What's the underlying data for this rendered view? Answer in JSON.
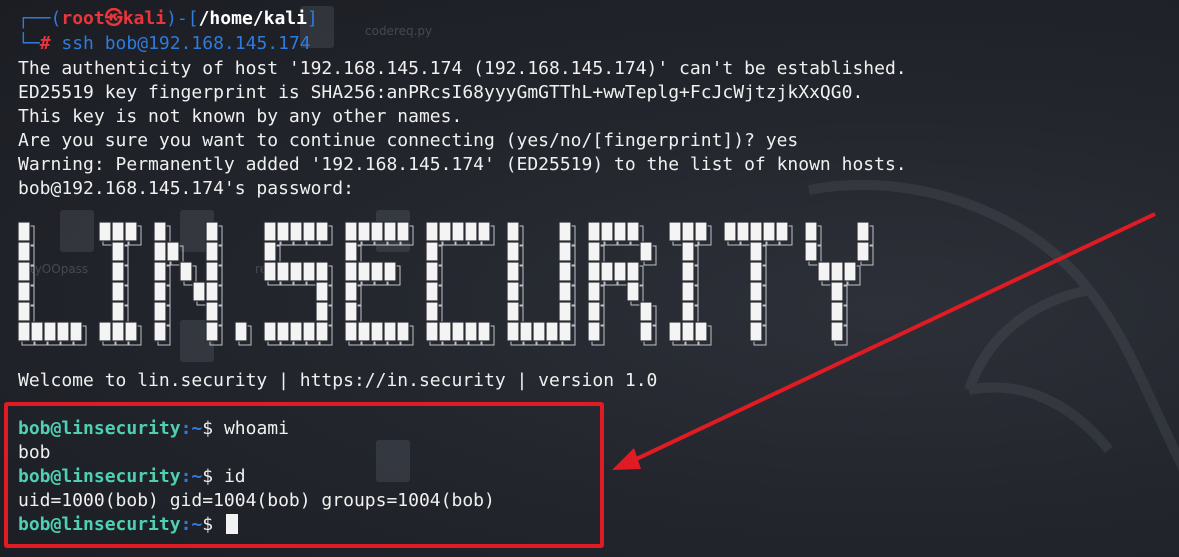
{
  "prompt_header": {
    "user": "root",
    "skull": "㉿",
    "host": "kali",
    "path": "/home/kali",
    "command": "ssh bob@192.168.145.174"
  },
  "ssh_output": [
    "The authenticity of host '192.168.145.174 (192.168.145.174)' can't be established.",
    "ED25519 key fingerprint is SHA256:anPRcsI68yyyGmGTThL+wwTeplg+FcJcWjtzjkXxQG0.",
    "This key is not known by any other names.",
    "Are you sure you want to continue connecting (yes/no/[fingerprint])? yes",
    "Warning: Permanently added '192.168.145.174' (ED25519) to the list of known hosts.",
    "bob@192.168.145.174's password:"
  ],
  "banner": {
    "text": "LIN.SECURITY",
    "welcome": "Welcome to lin.security | https://in.security | version 1.0"
  },
  "session": {
    "user_host": "bob@linsecurity",
    "path": ":~",
    "dollar": "$",
    "cmd1": "whoami",
    "out1": "bob",
    "cmd2": "id",
    "out2": "uid=1000(bob) gid=1004(bob) groups=1004(bob)"
  },
  "desktop_ghosts": {
    "file1": "codereq.py",
    "file2": "tyOOpass",
    "file3": "rectory"
  },
  "colors": {
    "annotation": "#e01b24",
    "prompt_user": "#4fd0b3",
    "prompt_path": "#2f7bdc",
    "root_red": "#e9353c"
  }
}
